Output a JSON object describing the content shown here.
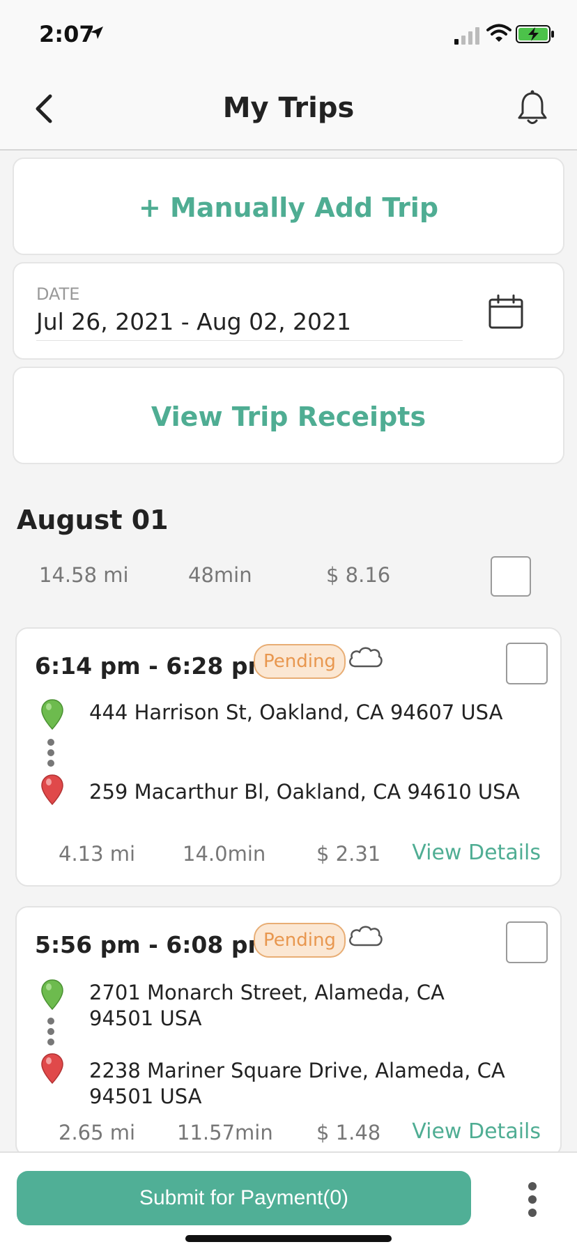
{
  "status_bar": {
    "time": "2:07"
  },
  "nav": {
    "title": "My Trips"
  },
  "actions": {
    "add_trip": "+ Manually Add Trip",
    "view_receipts": "View Trip Receipts"
  },
  "date_filter": {
    "label": "DATE",
    "value": "Jul 26, 2021 - Aug 02, 2021"
  },
  "day": {
    "heading": "August 01",
    "distance": "14.58 mi",
    "duration": "48min",
    "amount": "$ 8.16",
    "checked": false
  },
  "trips": [
    {
      "time_range": "6:14 pm - 6:28 pm",
      "status": "Pending",
      "from": "444 Harrison St, Oakland, CA 94607 USA",
      "to": "259 Macarthur Bl, Oakland, CA 94610 USA",
      "distance": "4.13 mi",
      "duration": "14.0min",
      "amount": "$ 2.31",
      "details_label": "View Details",
      "checked": false
    },
    {
      "time_range": "5:56 pm - 6:08 pm",
      "status": "Pending",
      "from": "2701 Monarch Street, Alameda, CA 94501 USA",
      "to": "2238 Mariner Square Drive, Alameda, CA 94501 USA",
      "distance": "2.65 mi",
      "duration": "11.57min",
      "amount": "$ 1.48",
      "details_label": "View Details",
      "checked": false
    }
  ],
  "bottom": {
    "submit_label": "Submit for Payment(0)"
  },
  "colors": {
    "accent": "#4fad93",
    "pending_border": "#e8ad74",
    "pending_fill": "#fbe7d3",
    "pin_start": "#6dbb4e",
    "pin_end": "#e0494a"
  }
}
